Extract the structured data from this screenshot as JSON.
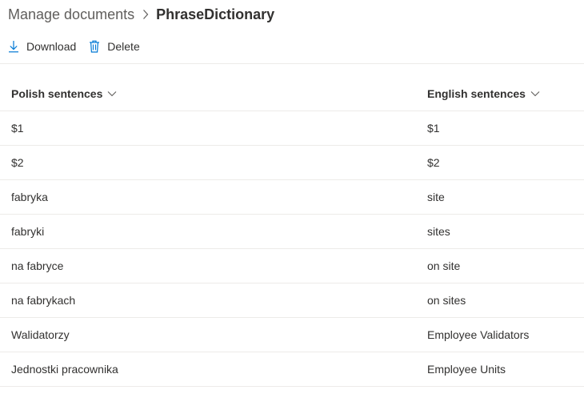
{
  "breadcrumb": {
    "parent": "Manage documents",
    "current": "PhraseDictionary"
  },
  "toolbar": {
    "download_label": "Download",
    "delete_label": "Delete"
  },
  "colors": {
    "accent": "#0078d4",
    "text": "#323130",
    "secondary_text": "#605e5c",
    "divider": "#edebe9"
  },
  "icons": {
    "breadcrumb_separator": "chevron-right-icon",
    "download": "download-icon",
    "delete": "trash-icon",
    "column_sort": "chevron-down-icon"
  },
  "table": {
    "columns": [
      "Polish sentences",
      "English sentences"
    ],
    "rows": [
      [
        "$1",
        "$1"
      ],
      [
        "$2",
        "$2"
      ],
      [
        "fabryka",
        "site"
      ],
      [
        "fabryki",
        "sites"
      ],
      [
        "na fabryce",
        "on site"
      ],
      [
        "na fabrykach",
        "on sites"
      ],
      [
        "Walidatorzy",
        "Employee Validators"
      ],
      [
        "Jednostki pracownika",
        "Employee Units"
      ]
    ]
  }
}
